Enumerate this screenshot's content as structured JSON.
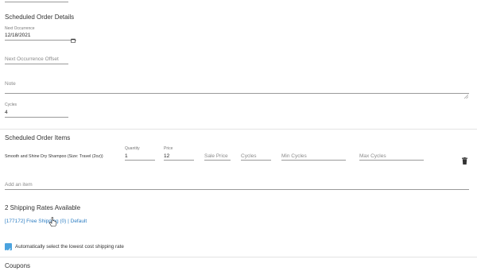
{
  "details": {
    "title": "Scheduled Order Details",
    "next_occurrence_label": "Next Occurrence",
    "next_occurrence_value": "12/18/2021",
    "offset_placeholder": "Next Occurrence Offset",
    "note_placeholder": "Note",
    "cycles_label": "Cycles",
    "cycles_value": "4"
  },
  "items": {
    "title": "Scheduled Order Items",
    "rows": [
      {
        "name": "Smooth and Shine Dry Shampoo (Size: Travel (2oz))",
        "quantity_label": "Quantity",
        "quantity": "1",
        "price_label": "Price",
        "price": "12",
        "sale_price_placeholder": "Sale Price",
        "cycles_placeholder": "Cycles",
        "min_cycles_placeholder": "Min Cycles",
        "max_cycles_placeholder": "Max Cycles"
      }
    ],
    "add_placeholder": "Add an item"
  },
  "shipping": {
    "title": "2 Shipping Rates Available",
    "rate_link": "[177172] Free Shipping (0) | Default",
    "auto_select_label": "Automatically select the lowest cost shipping rate",
    "auto_select_checked": true
  },
  "coupons": {
    "title": "Coupons"
  },
  "icons": {
    "calendar": "calendar-icon",
    "delete": "trash-icon",
    "cursor": "hand-pointer-icon",
    "check": "checkmark-icon"
  },
  "colors": {
    "accent": "#2d7ec3",
    "checkbox": "#4aa3df"
  }
}
